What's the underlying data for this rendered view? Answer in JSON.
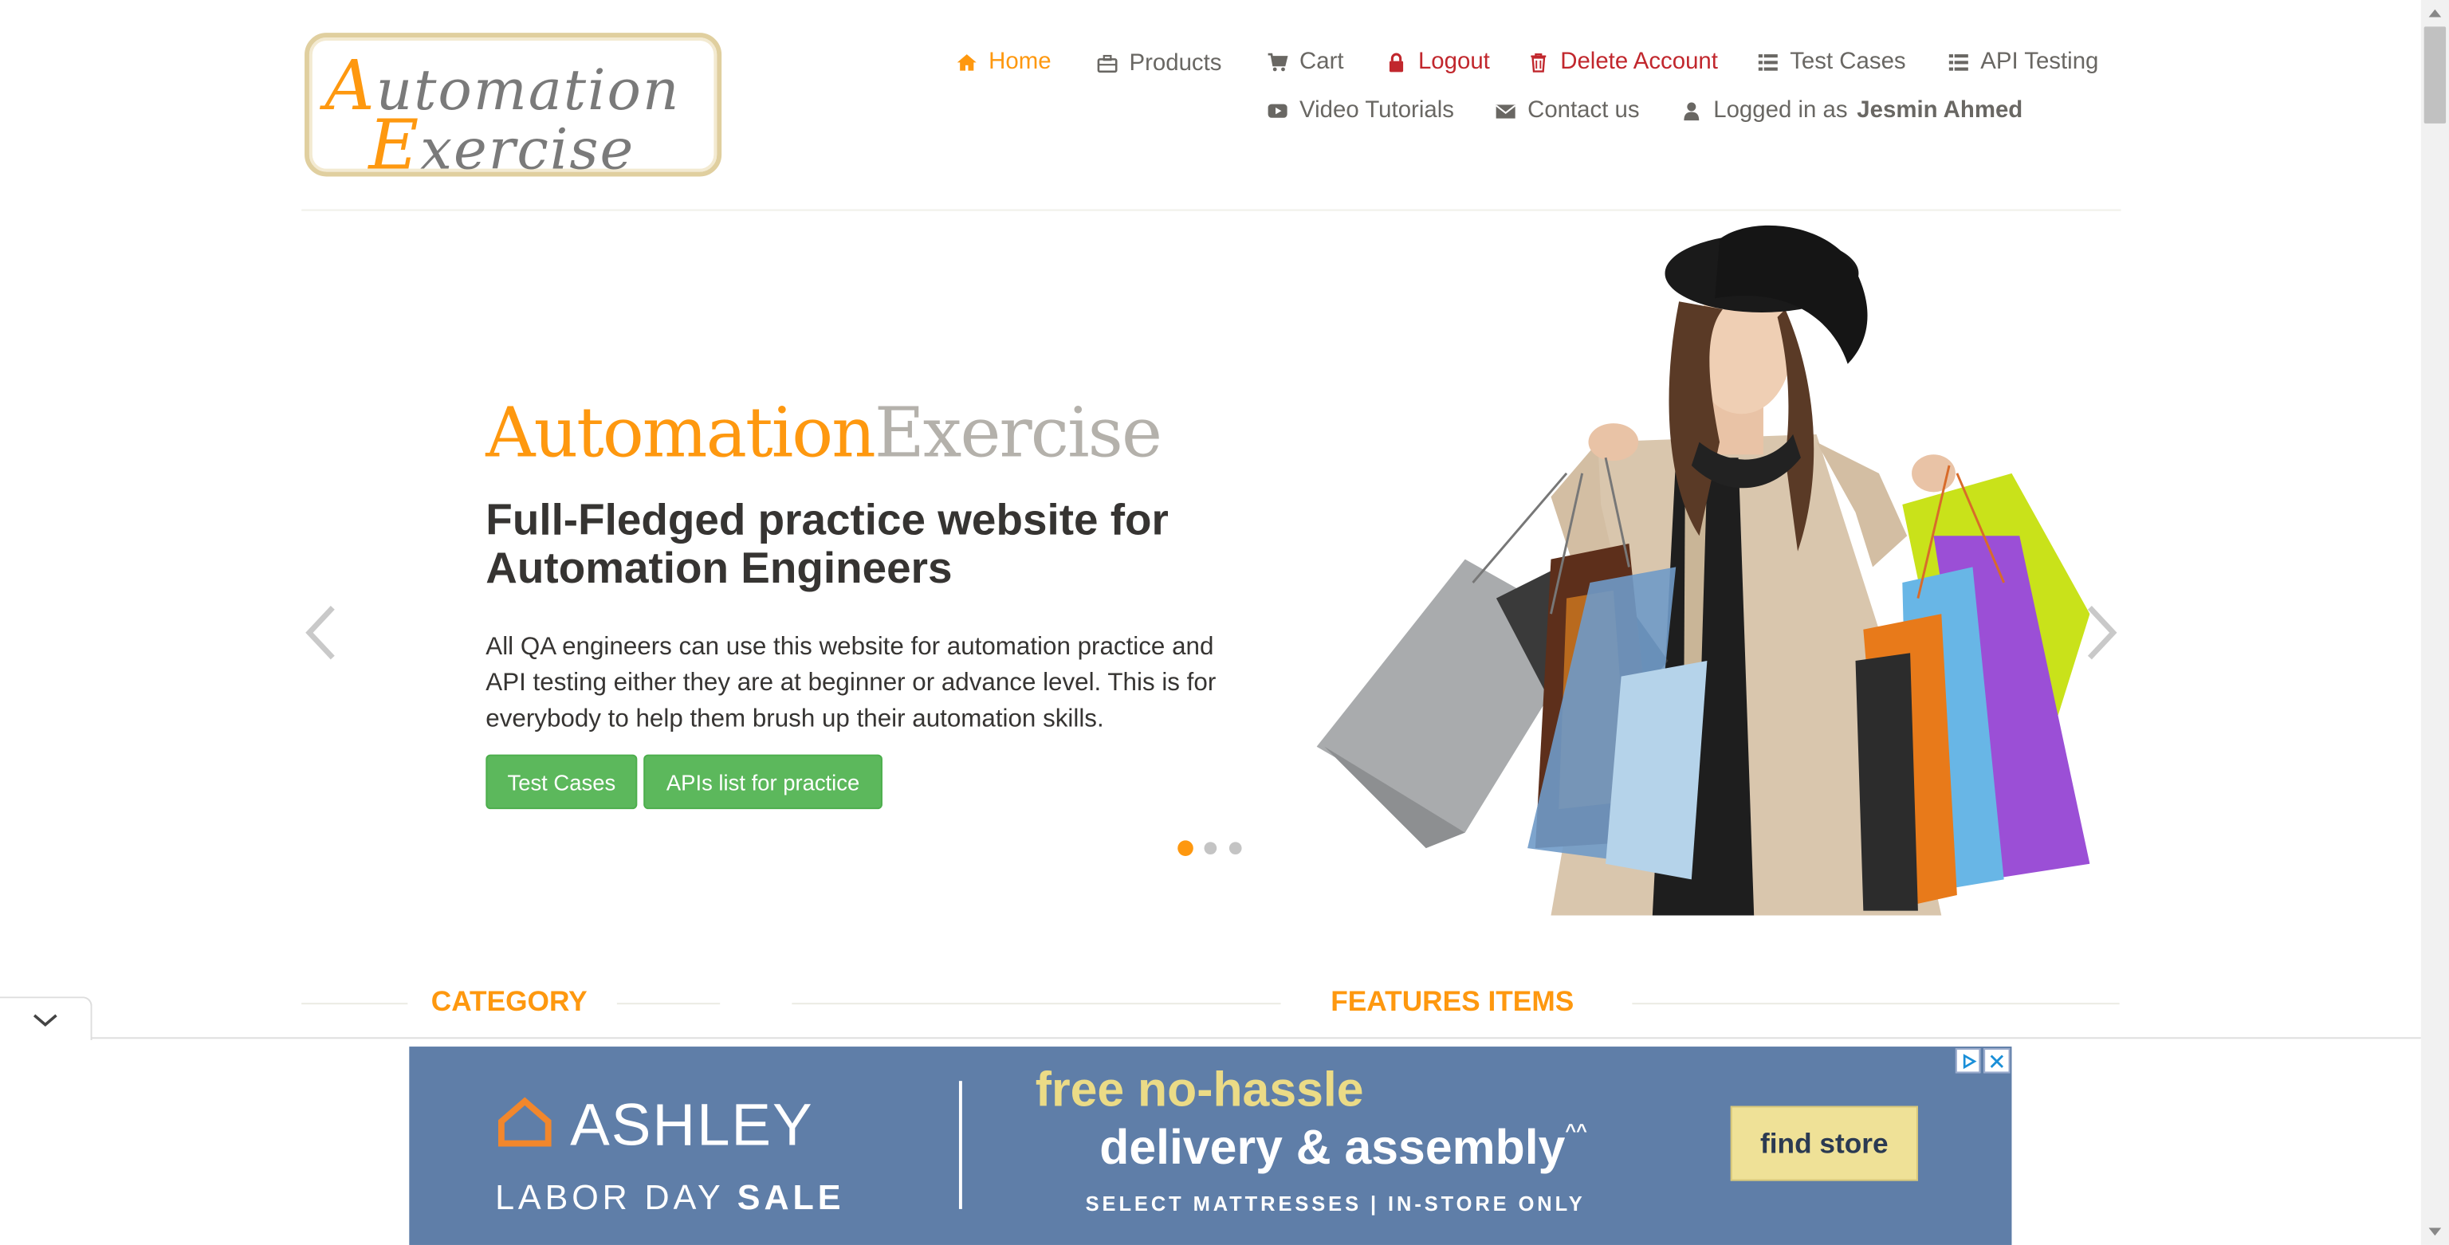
{
  "logo": {
    "line1_cap": "A",
    "line1_rest": "utomation",
    "line2_cap": "E",
    "line2_rest": "xercise"
  },
  "nav": {
    "home": "Home",
    "products": "Products",
    "cart": "Cart",
    "logout": "Logout",
    "delete_account": "Delete Account",
    "test_cases": "Test Cases",
    "api_testing": "API Testing",
    "video_tutorials": "Video Tutorials",
    "contact_us": "Contact us",
    "logged_in_prefix": "Logged in as",
    "logged_in_user": "Jesmin Ahmed"
  },
  "slider": {
    "brand_a": "Automation",
    "brand_b": "Exercise",
    "headline": "Full-Fledged practice website for Automation Engineers",
    "description": "All QA engineers can use this website for automation practice and API testing either they are at beginner or advance level. This is for everybody to help them brush up their automation skills.",
    "btn_test_cases": "Test Cases",
    "btn_apis": "APIs list for practice",
    "active_slide": 1,
    "slide_count": 3
  },
  "sections": {
    "category": "CATEGORY",
    "features": "FEATURES ITEMS"
  },
  "ad": {
    "brand": "ASHLEY",
    "labor_light": "LABOR DAY",
    "labor_bold": "SALE",
    "free": "free no-hassle",
    "delivery": "delivery & assembly",
    "delivery_sup": "^^",
    "select": "SELECT MATTRESSES | IN-STORE ONLY",
    "find_store": "find store"
  },
  "colors": {
    "accent": "#fe980f",
    "danger": "#c1272d",
    "button_green": "#5cb85c",
    "text": "#696763",
    "ad_bg": "#5f7ea8"
  }
}
